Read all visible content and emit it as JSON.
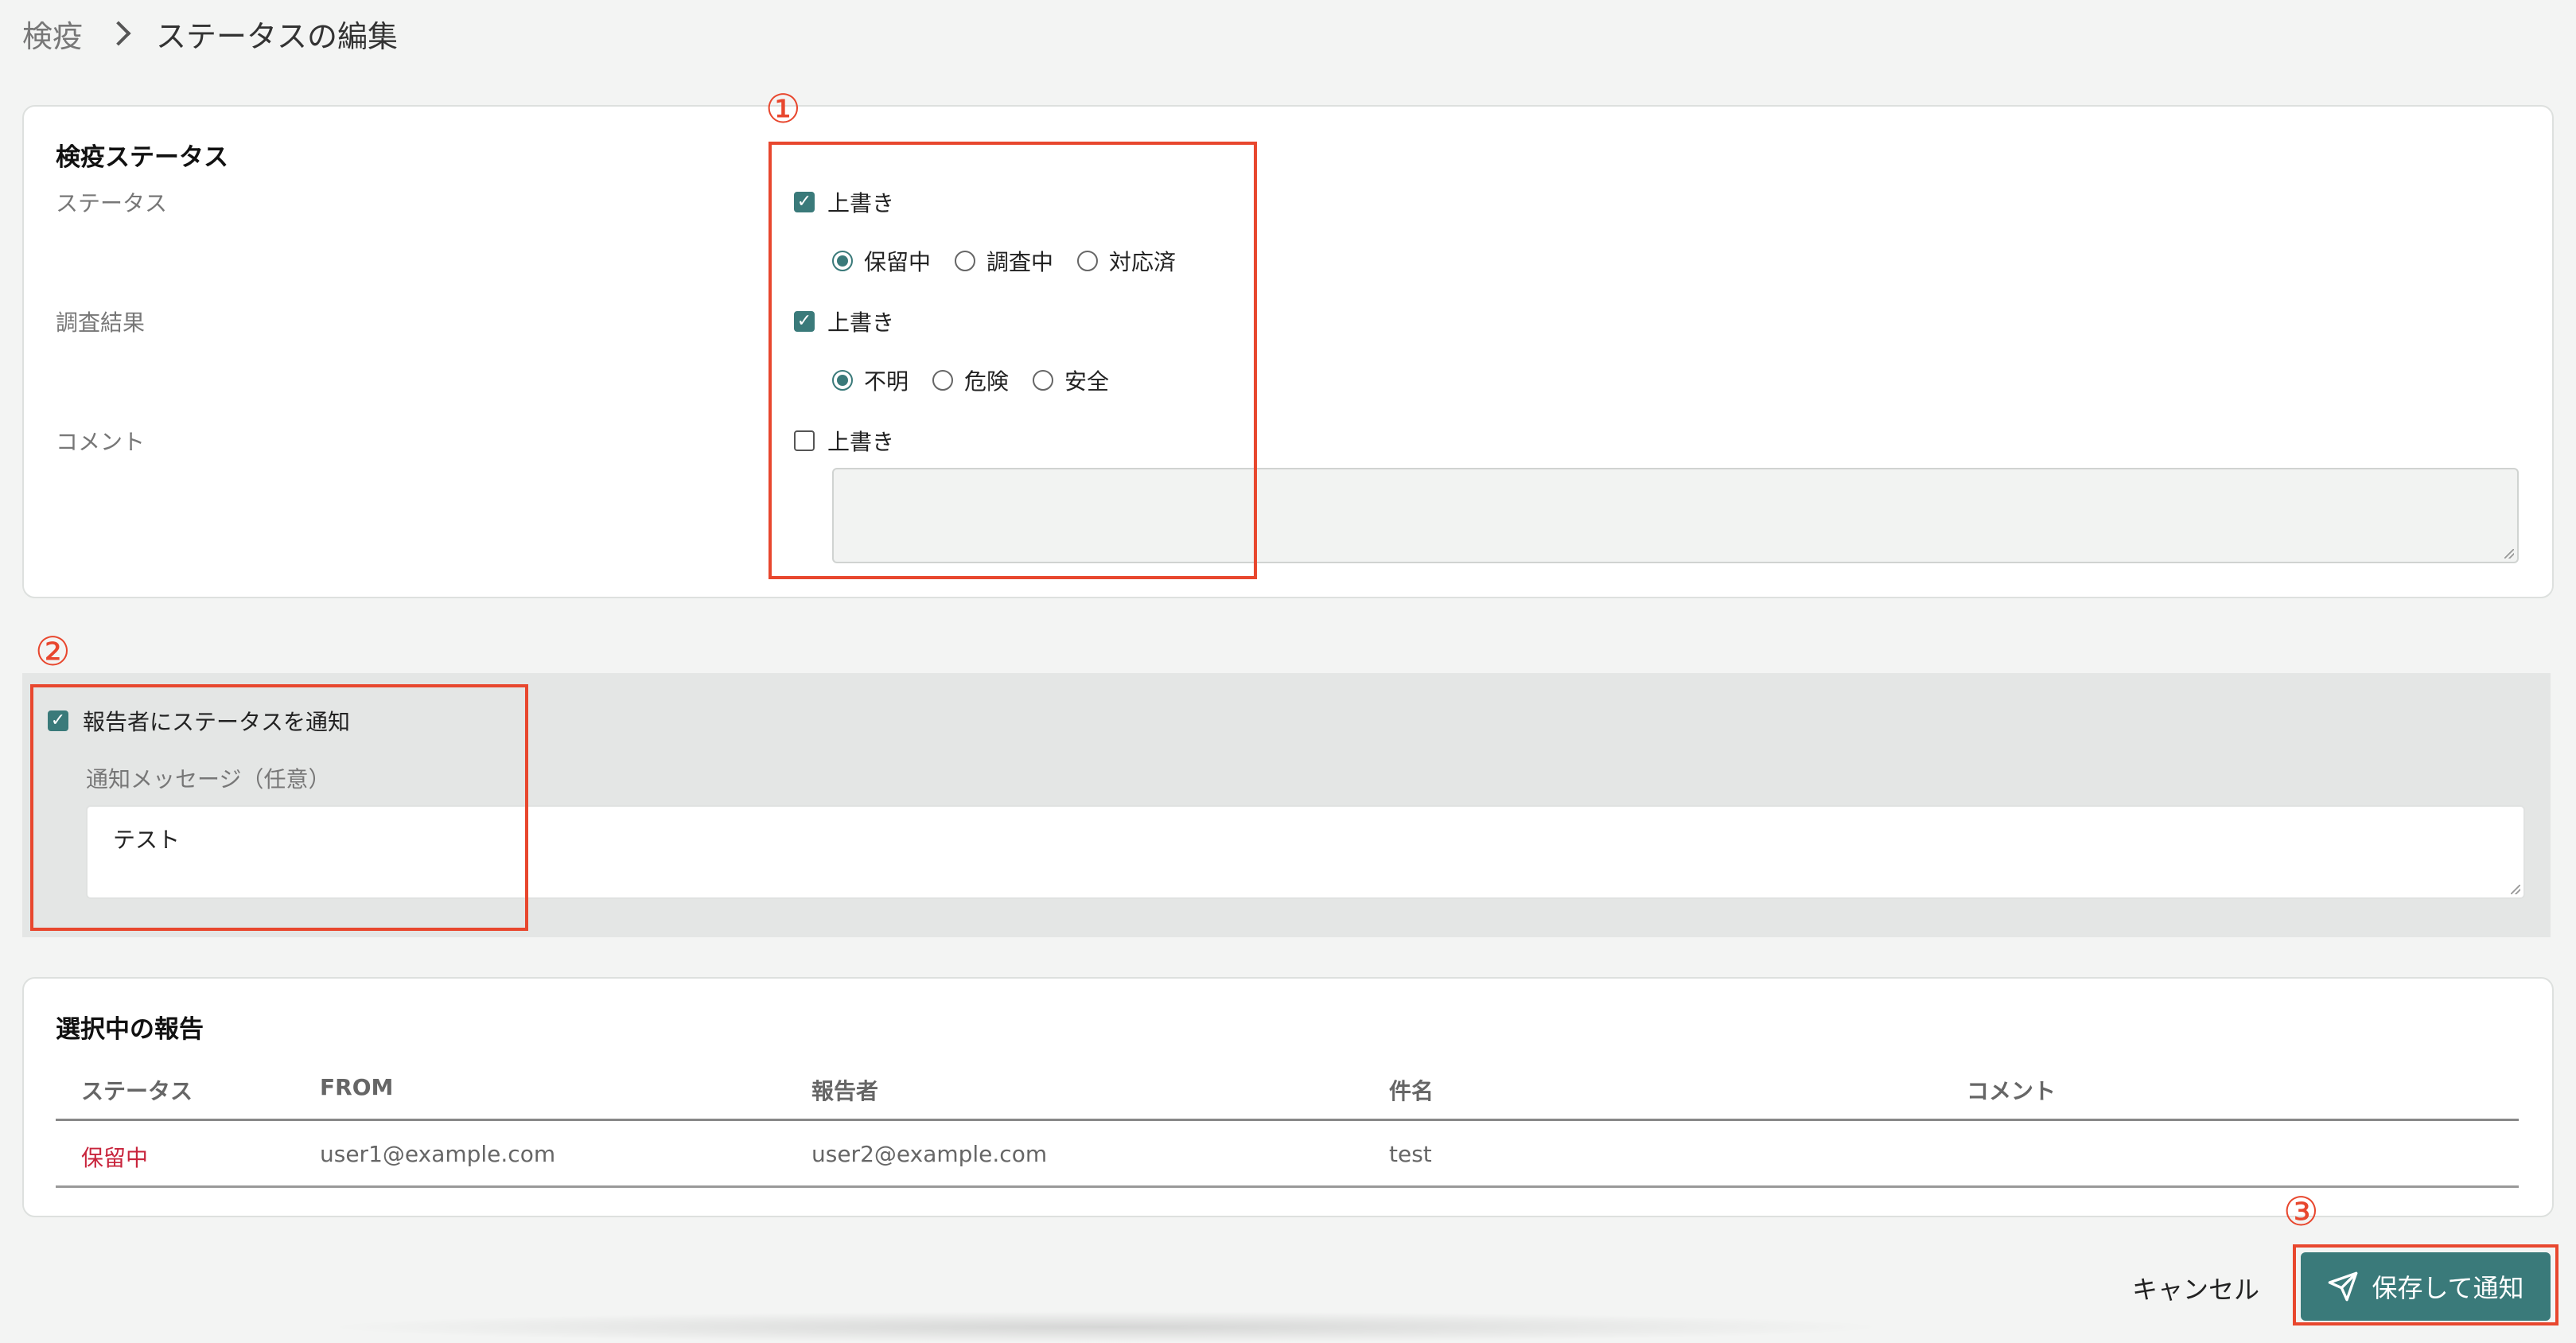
{
  "breadcrumb": {
    "parent": "検疫",
    "current": "ステータスの編集"
  },
  "quarantine": {
    "title": "検疫ステータス",
    "status_label": "ステータス",
    "status_override": {
      "label": "上書き",
      "checked": true
    },
    "status_options": [
      {
        "label": "保留中",
        "selected": true
      },
      {
        "label": "調査中",
        "selected": false
      },
      {
        "label": "対応済",
        "selected": false
      }
    ],
    "result_label": "調査結果",
    "result_override": {
      "label": "上書き",
      "checked": true
    },
    "result_options": [
      {
        "label": "不明",
        "selected": true
      },
      {
        "label": "危険",
        "selected": false
      },
      {
        "label": "安全",
        "selected": false
      }
    ],
    "comment_label": "コメント",
    "comment_override": {
      "label": "上書き",
      "checked": false
    },
    "comment_value": ""
  },
  "notify": {
    "label": "報告者にステータスを通知",
    "checked": true,
    "message_label": "通知メッセージ（任意）",
    "message_value": "テスト"
  },
  "selected_reports": {
    "title": "選択中の報告",
    "columns": [
      "ステータス",
      "FROM",
      "報告者",
      "件名",
      "コメント"
    ],
    "rows": [
      {
        "status": "保留中",
        "from": "user1@example.com",
        "reporter": "user2@example.com",
        "subject": "test",
        "comment": ""
      }
    ]
  },
  "footer": {
    "cancel_label": "キャンセル",
    "primary_label": "保存して通知"
  },
  "annotations": {
    "one": "①",
    "two": "②",
    "three": "③"
  },
  "colors": {
    "accent": "#3a7a7a",
    "annotation": "#e8472e",
    "status_pending": "#c8243c"
  },
  "icons": {
    "check": "check-icon",
    "send": "send-icon",
    "chevron": "chevron-right-icon"
  }
}
